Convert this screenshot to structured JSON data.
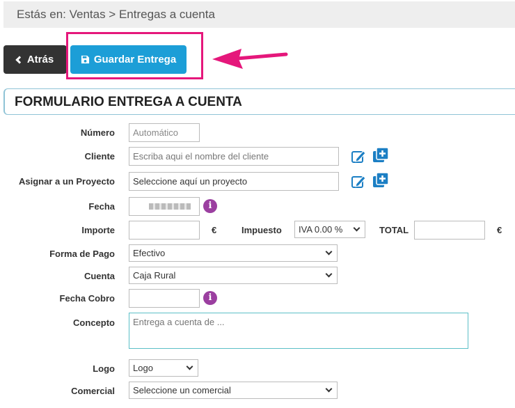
{
  "breadcrumb": "Estás en: Ventas > Entregas a cuenta",
  "toolbar": {
    "back_label": "Atrás",
    "save_label": "Guardar Entrega"
  },
  "form": {
    "title": "FORMULARIO ENTREGA A CUENTA",
    "numero": {
      "label": "Número",
      "placeholder": "Automático"
    },
    "cliente": {
      "label": "Cliente",
      "placeholder": "Escriba aqui el nombre del cliente"
    },
    "proyecto": {
      "label": "Asignar a un Proyecto",
      "placeholder": "Seleccione aquí un proyecto"
    },
    "fecha": {
      "label": "Fecha"
    },
    "importe": {
      "label": "Importe",
      "currency": "€"
    },
    "impuesto": {
      "label": "Impuesto",
      "value": "IVA 0.00 %"
    },
    "total": {
      "label": "TOTAL",
      "currency": "€"
    },
    "forma_pago": {
      "label": "Forma de Pago",
      "value": "Efectivo"
    },
    "cuenta": {
      "label": "Cuenta",
      "value": "Caja Rural"
    },
    "fecha_cobro": {
      "label": "Fecha Cobro"
    },
    "concepto": {
      "label": "Concepto",
      "placeholder": "Entrega a cuenta de ..."
    },
    "logo": {
      "label": "Logo",
      "value": "Logo"
    },
    "comercial": {
      "label": "Comercial",
      "value": "Seleccione un comercial"
    }
  },
  "colors": {
    "accent": "#1c9ed7",
    "highlight": "#e5177b",
    "info": "#9b3fa0"
  }
}
